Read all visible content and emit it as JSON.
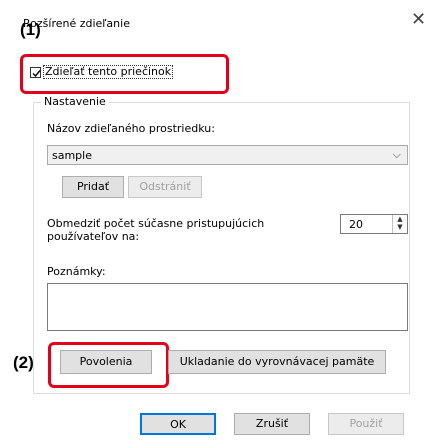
{
  "window": {
    "title": "Rozšírené zdieľanie",
    "close_icon": "close-icon"
  },
  "callouts": {
    "one": "(1)",
    "two": "(2)"
  },
  "share": {
    "checkbox_label": "Zdieľať tento priečinok",
    "checked": true
  },
  "settings": {
    "group_label": "Nastavenie",
    "share_name_label": "Názov zdieľaného prostriedku:",
    "share_name_value": "sample",
    "add_label": "Pridať",
    "remove_label": "Odstrániť",
    "limit_label": "Obmedziť počet súčasne pristupujúcich používateľov na:",
    "limit_value": "20",
    "comments_label": "Poznámky:",
    "comments_value": "",
    "permissions_label": "Povolenia",
    "caching_label": "Ukladanie do vyrovnávacej pamäte"
  },
  "footer": {
    "ok": "OK",
    "cancel": "Zrušiť",
    "apply": "Použiť"
  },
  "colors": {
    "callout": "#e3001b",
    "focus": "#0078d7"
  }
}
